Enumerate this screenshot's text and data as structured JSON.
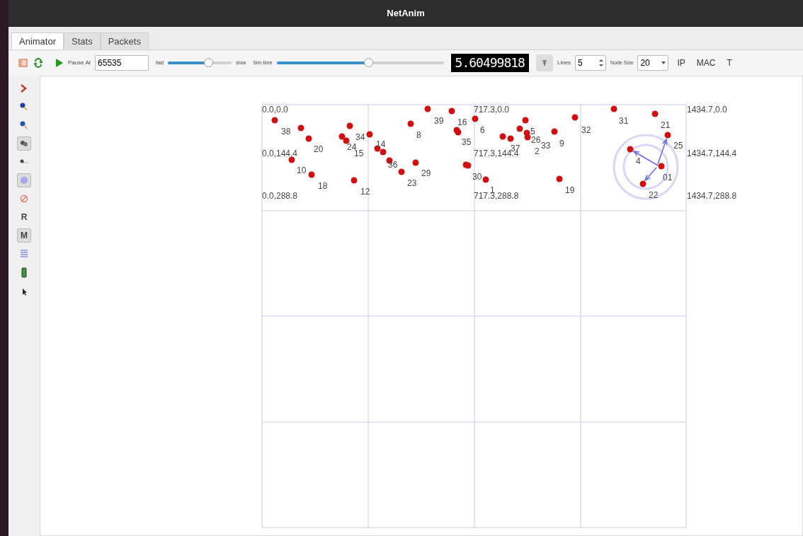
{
  "window": {
    "title": "NetAnim"
  },
  "tabs": [
    {
      "label": "Animator",
      "selected": true
    },
    {
      "label": "Stats",
      "selected": false
    },
    {
      "label": "Packets",
      "selected": false
    }
  ],
  "toolbar": {
    "pause_at_label": "Pause At",
    "pause_at_value": "65535",
    "fast_label": "fast",
    "slow_label": "slow",
    "speed": {
      "level": 0.63
    },
    "sim_time_label": "Sim time",
    "sim_time": {
      "level": 0.55
    },
    "time_display": "5.60499818",
    "lines_label": "Lines",
    "lines_value": "5",
    "node_size_label": "Node Size",
    "node_size_value": "20",
    "buttons": [
      "IP",
      "MAC",
      "T"
    ]
  },
  "side_tools": [
    {
      "kind": "chevron",
      "on": false
    },
    {
      "kind": "zoom-in",
      "on": false
    },
    {
      "kind": "zoom-out",
      "on": false
    },
    {
      "kind": "nodes",
      "on": true
    },
    {
      "kind": "trail",
      "on": false
    },
    {
      "kind": "circle",
      "on": true
    },
    {
      "kind": "stop",
      "on": false
    },
    {
      "kind": "text",
      "text": "R",
      "on": false
    },
    {
      "kind": "text",
      "text": "M",
      "on": true
    },
    {
      "kind": "lines",
      "on": false
    },
    {
      "kind": "battery",
      "on": false
    },
    {
      "kind": "pointer",
      "on": false
    }
  ],
  "grid_labels": [
    "0.0,0.0",
    "0.0,144.4",
    "0.0,288.8",
    "717.3,0.0",
    "717.3,144.4",
    "717.3,288.8",
    "1434.7,0.0",
    "1434.7,144.4",
    "1434.7,288.8"
  ],
  "node_labels": [
    "38",
    "20",
    "24",
    "15",
    "34",
    "10",
    "18",
    "12",
    "14",
    "39",
    "16",
    "8",
    "36",
    "23",
    "29",
    "6",
    "5",
    "26",
    "37",
    "2",
    "33",
    "9",
    "32",
    "31",
    "21",
    "25",
    "4",
    "01",
    "22",
    "19",
    "35",
    "30",
    "1"
  ]
}
